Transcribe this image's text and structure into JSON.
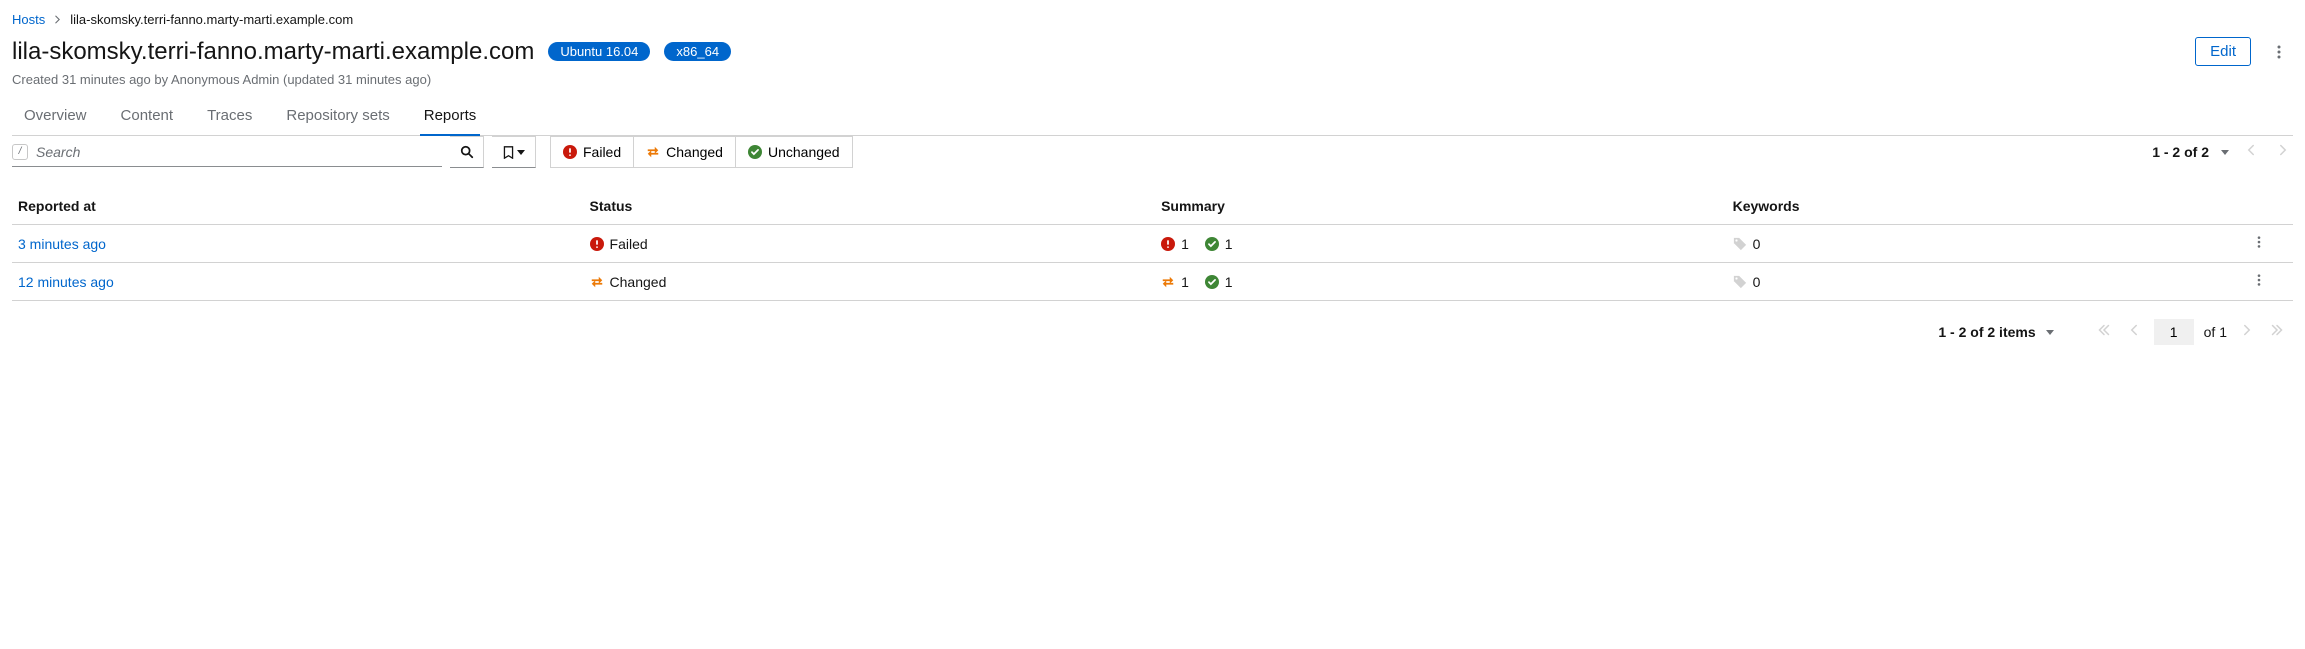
{
  "breadcrumb": {
    "root": "Hosts",
    "current": "lila-skomsky.terri-fanno.marty-marti.example.com"
  },
  "header": {
    "title": "lila-skomsky.terri-fanno.marty-marti.example.com",
    "os_badge": "Ubuntu 16.04",
    "arch_badge": "x86_64",
    "edit_label": "Edit",
    "subtitle": "Created 31 minutes ago by Anonymous Admin (updated 31 minutes ago)"
  },
  "tabs": [
    {
      "label": "Overview"
    },
    {
      "label": "Content"
    },
    {
      "label": "Traces"
    },
    {
      "label": "Repository sets"
    },
    {
      "label": "Reports",
      "active": true
    }
  ],
  "search": {
    "placeholder": "Search"
  },
  "filters": {
    "failed": "Failed",
    "changed": "Changed",
    "unchanged": "Unchanged"
  },
  "pager_top": {
    "text": "1 - 2 of 2"
  },
  "table": {
    "columns": {
      "reported_at": "Reported at",
      "status": "Status",
      "summary": "Summary",
      "keywords": "Keywords"
    },
    "rows": [
      {
        "reported_at": "3 minutes ago",
        "status": {
          "kind": "failed",
          "label": "Failed"
        },
        "summary": {
          "failed": "1",
          "ok": "1"
        },
        "keywords": "0"
      },
      {
        "reported_at": "12 minutes ago",
        "status": {
          "kind": "changed",
          "label": "Changed"
        },
        "summary": {
          "changed": "1",
          "ok": "1"
        },
        "keywords": "0"
      }
    ]
  },
  "footer": {
    "range": "1 - 2 of 2 items",
    "page": "1",
    "of": "of 1"
  }
}
